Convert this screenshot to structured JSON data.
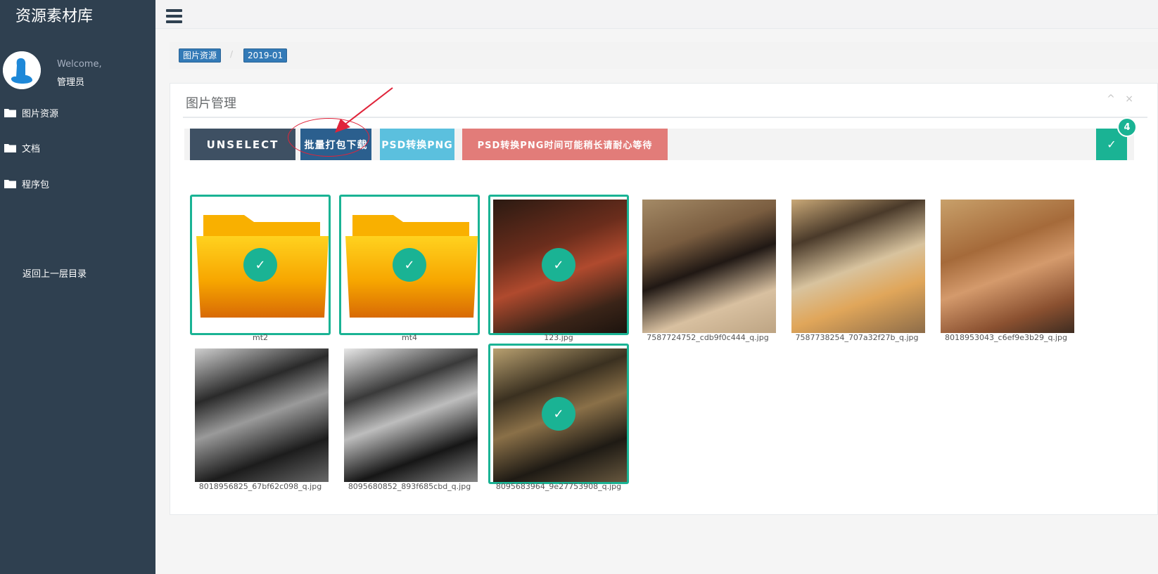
{
  "sidebar": {
    "app_title": "资源素材库",
    "welcome": "Welcome,",
    "username": "管理员",
    "nav": [
      {
        "label": "图片资源",
        "icon": "folder-icon"
      },
      {
        "label": "文档",
        "icon": "folder-icon"
      },
      {
        "label": "程序包",
        "icon": "folder-icon"
      }
    ],
    "back_link": "返回上一层目录"
  },
  "breadcrumb": [
    "图片资源",
    "2019-01"
  ],
  "breadcrumb_separator": "/",
  "panel": {
    "title": "图片管理",
    "tools": {
      "collapse": "^",
      "close": "×"
    }
  },
  "toolbar": {
    "unselect": "UNSELECT",
    "download": "批量打包下载",
    "psd": "PSD转换PNG",
    "wait": "PSD转换PNG时间可能稍长请耐心等待",
    "confirm_icon": "✓",
    "selected_count": "4"
  },
  "gallery": [
    {
      "name": "mt2",
      "kind": "folder",
      "selected": true
    },
    {
      "name": "mt4",
      "kind": "folder",
      "selected": true
    },
    {
      "name": "123.jpg",
      "kind": "photo",
      "selected": true
    },
    {
      "name": "7587724752_cdb9f0c444_q.jpg",
      "kind": "photo",
      "selected": false
    },
    {
      "name": "7587738254_707a32f27b_q.jpg",
      "kind": "photo",
      "selected": false
    },
    {
      "name": "8018953043_c6ef9e3b29_q.jpg",
      "kind": "photo",
      "selected": false
    },
    {
      "name": "8018956825_67bf62c098_q.jpg",
      "kind": "photo",
      "selected": false
    },
    {
      "name": "8095680852_893f685cbd_q.jpg",
      "kind": "photo",
      "selected": false
    },
    {
      "name": "8095683964_9e27753908_q.jpg",
      "kind": "photo",
      "selected": true
    }
  ],
  "colors": {
    "sidebar": "#2f4050",
    "accent": "#1ab394",
    "primary": "#337ab7",
    "danger_soft": "#e27c79",
    "info": "#5bc0de"
  }
}
